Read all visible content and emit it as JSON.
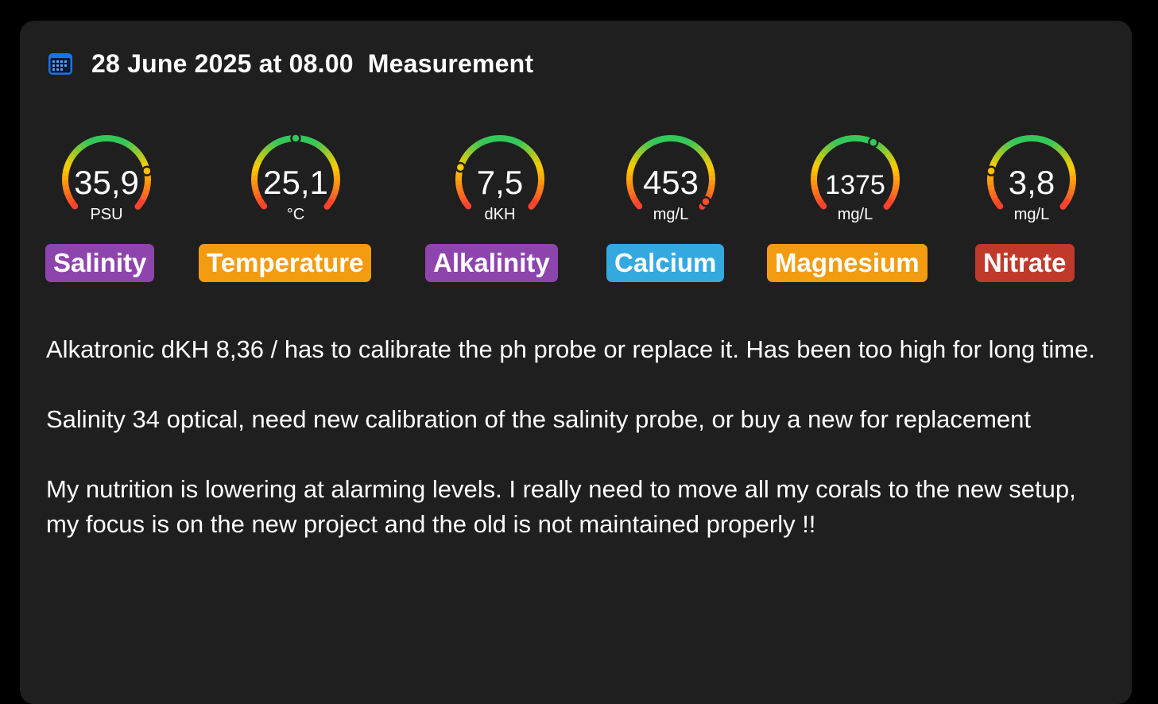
{
  "header": {
    "date": "28 June 2025 at 08.00",
    "type": "Measurement"
  },
  "gauges": [
    {
      "value": "35,9",
      "unit": "PSU",
      "level": 0.8,
      "label": "Salinity",
      "color": "#8e44ad"
    },
    {
      "value": "25,1",
      "unit": "°C",
      "level": 0.5,
      "label": "Temperature",
      "color": "#f39c12"
    },
    {
      "value": "7,5",
      "unit": "dKH",
      "level": 0.22,
      "label": "Alkalinity",
      "color": "#8e44ad"
    },
    {
      "value": "453",
      "unit": "mg/L",
      "level": 0.97,
      "label": "Calcium",
      "color": "#34a9df"
    },
    {
      "value": "1375",
      "unit": "mg/L",
      "level": 0.6,
      "label": "Magnesium",
      "color": "#f39c12"
    },
    {
      "value": "3,8",
      "unit": "mg/L",
      "level": 0.2,
      "label": "Nitrate",
      "color": "#c0392b"
    }
  ],
  "notes": [
    "Alkatronic dKH 8,36 / has to calibrate the ph probe or replace it. Has been too high for long time.",
    "Salinity 34 optical, need new calibration of the salinity probe, or buy a new for replacement",
    "My nutrition is lowering at alarming levels. I really need to move all my corals to the new setup, my focus is on the new project and the old is not maintained properly !!"
  ],
  "icons": {
    "calendar": "calendar-icon"
  },
  "colors": {
    "card_bg": "#1f1f1f",
    "page_bg": "#000000",
    "calendar_blue": "#1a73e8"
  }
}
